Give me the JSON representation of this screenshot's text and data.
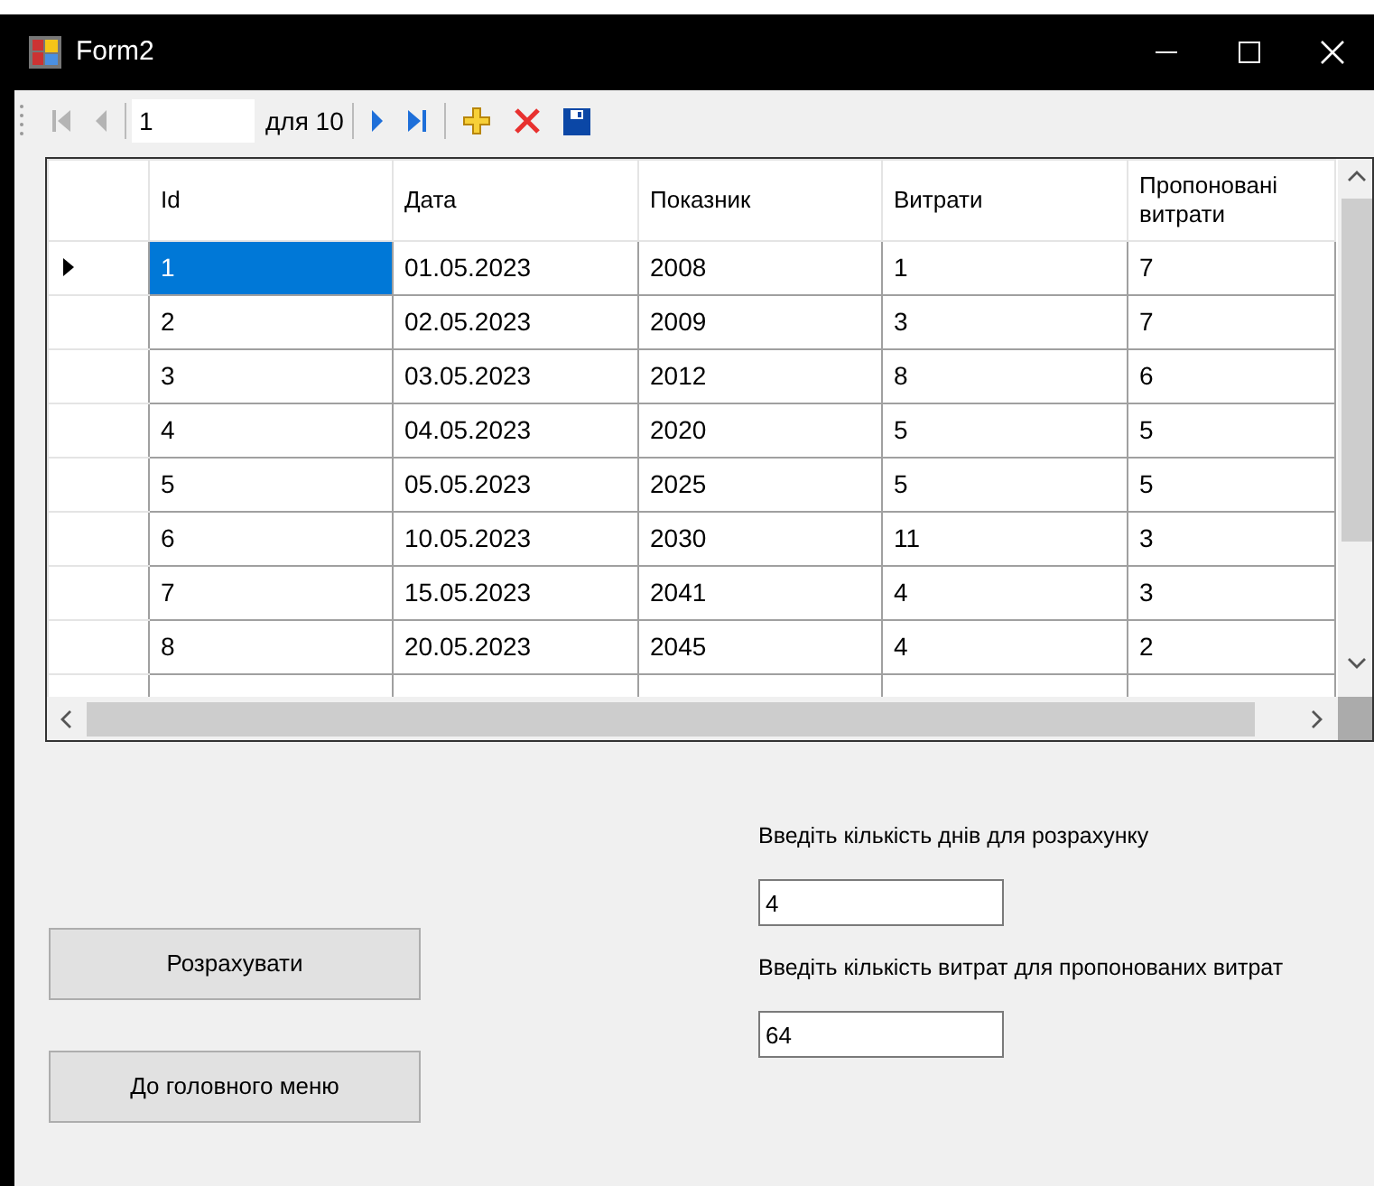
{
  "window": {
    "title": "Form2"
  },
  "navigator": {
    "items": [
      {
        "kind": "first",
        "disabled": true
      },
      {
        "kind": "prev",
        "disabled": true
      },
      {
        "kind": "position",
        "value": "1"
      },
      {
        "kind": "count",
        "text": "для 10"
      },
      {
        "kind": "next",
        "disabled": false
      },
      {
        "kind": "last",
        "disabled": false
      },
      {
        "kind": "add",
        "disabled": false
      },
      {
        "kind": "delete",
        "disabled": false
      },
      {
        "kind": "save",
        "disabled": false
      }
    ]
  },
  "table": {
    "columns": [
      "Id",
      "Дата",
      "Показник",
      "Витрати",
      "Пропоновані витрати"
    ],
    "rows": [
      {
        "cells": [
          "1",
          "01.05.2023",
          "2008",
          "1",
          "7"
        ],
        "selected": true
      },
      {
        "cells": [
          "2",
          "02.05.2023",
          "2009",
          "3",
          "7"
        ],
        "selected": false
      },
      {
        "cells": [
          "3",
          "03.05.2023",
          "2012",
          "8",
          "6"
        ],
        "selected": false
      },
      {
        "cells": [
          "4",
          "04.05.2023",
          "2020",
          "5",
          "5"
        ],
        "selected": false
      },
      {
        "cells": [
          "5",
          "05.05.2023",
          "2025",
          "5",
          "5"
        ],
        "selected": false
      },
      {
        "cells": [
          "6",
          "10.05.2023",
          "2030",
          "11",
          "3"
        ],
        "selected": false
      },
      {
        "cells": [
          "7",
          "15.05.2023",
          "2041",
          "4",
          "3"
        ],
        "selected": false
      },
      {
        "cells": [
          "8",
          "20.05.2023",
          "2045",
          "4",
          "2"
        ],
        "selected": false
      }
    ]
  },
  "buttons": [
    "Розрахувати",
    "До головного меню"
  ],
  "fields": [
    {
      "label": "Введіть кількість днів для розрахунку",
      "value": "4"
    },
    {
      "label": "Введіть кількість витрат для пропонованих витрат",
      "value": "64"
    }
  ]
}
